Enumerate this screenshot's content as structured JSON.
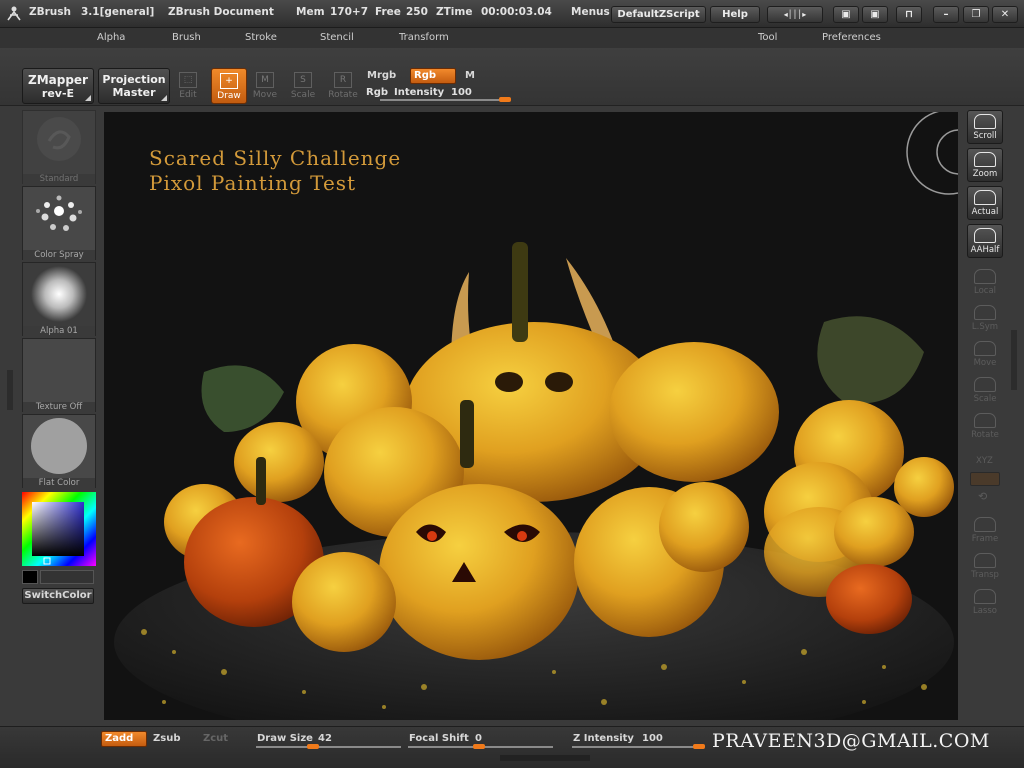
{
  "titlebar": {
    "app_name": "ZBrush",
    "version": "3.1[general]",
    "document": "ZBrush Document",
    "mem": "Mem",
    "mem_value": "170+7",
    "free": "Free",
    "free_value": "250",
    "ztime": "ZTime",
    "ztime_value": "00:00:03.04",
    "menus_label": "Menus",
    "script_label": "DefaultZScript",
    "help_label": "Help"
  },
  "menu": {
    "items": [
      "Alpha",
      "Brush",
      "Stroke",
      "Stencil",
      "Transform",
      "Tool",
      "Preferences"
    ]
  },
  "toolbar": {
    "zmapper_line1": "ZMapper",
    "zmapper_line2": "rev-E",
    "projection_line1": "Projection",
    "projection_line2": "Master",
    "tools": [
      "Edit",
      "Draw",
      "Move",
      "Scale",
      "Rotate"
    ],
    "mrgb": "Mrgb",
    "rgb": "Rgb",
    "m": "M",
    "rgb_intensity_label": "Rgb",
    "rgb_intensity_name": "Intensity",
    "rgb_intensity_value": "100",
    "rgb_intensity_level": 1.0
  },
  "left_panel": {
    "brush_label": "Standard",
    "stroke_label": "Color Spray",
    "alpha_label": "Alpha 01",
    "texture_label": "Texture Off",
    "material_label": "Flat Color",
    "switch_color": "SwitchColor"
  },
  "right_panel": {
    "buttons": [
      "Scroll",
      "Zoom",
      "Actual",
      "AAHalf",
      "Local",
      "L.Sym",
      "Move",
      "Scale",
      "Rotate",
      "Frame",
      "Transp",
      "Lasso"
    ],
    "xyz": "XYZ"
  },
  "canvas": {
    "title_line1": "Scared Silly Challenge",
    "title_line2": "Pixol Painting Test"
  },
  "bottombar": {
    "zadd": "Zadd",
    "zsub": "Zsub",
    "zcut": "Zcut",
    "draw_size_label": "Draw Size",
    "draw_size_value": "42",
    "focal_shift_label": "Focal Shift",
    "focal_shift_value": "0",
    "z_intensity_label": "Z Intensity",
    "z_intensity_value": "100",
    "email": "PRAVEEN3D@GMAIL.COM"
  },
  "colors": {
    "accent": "#f07a1a",
    "pumpkin": "#e0a020",
    "canvas_bg": "#121212"
  }
}
